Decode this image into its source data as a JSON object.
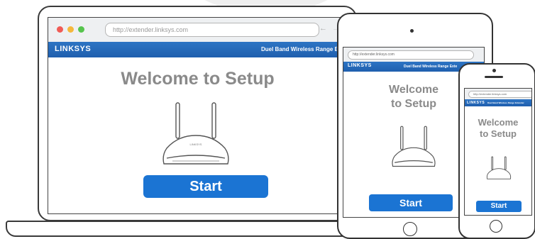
{
  "laptop": {
    "url": "http://extender.linksys.com",
    "brand": "LINKSYS",
    "tagline": "Duel Band Wireless Range Ex",
    "welcome": "Welcome to Setup",
    "start_label": "Start"
  },
  "tablet": {
    "url": "http://extender.linksys.com",
    "brand": "LINKSYS",
    "tagline": "Duel Band Wireless Range Exte",
    "welcome_line1": "Welcome",
    "welcome_line2": "to Setup",
    "start_label": "Start"
  },
  "phone": {
    "url": "http://extender.linksys.com",
    "brand": "LINKSYS",
    "tagline": "Duel Band Wireless Range Extender",
    "welcome_line1": "Welcome",
    "welcome_line2": "to Setup",
    "start_label": "Start"
  },
  "router_label": "LINKSYS",
  "colors": {
    "banner": "#1f5fae",
    "button": "#1b74d3",
    "welcome_text": "#8a8a8a",
    "dot_red": "#f05b55",
    "dot_yellow": "#f5b83c",
    "dot_green": "#56c44d"
  }
}
